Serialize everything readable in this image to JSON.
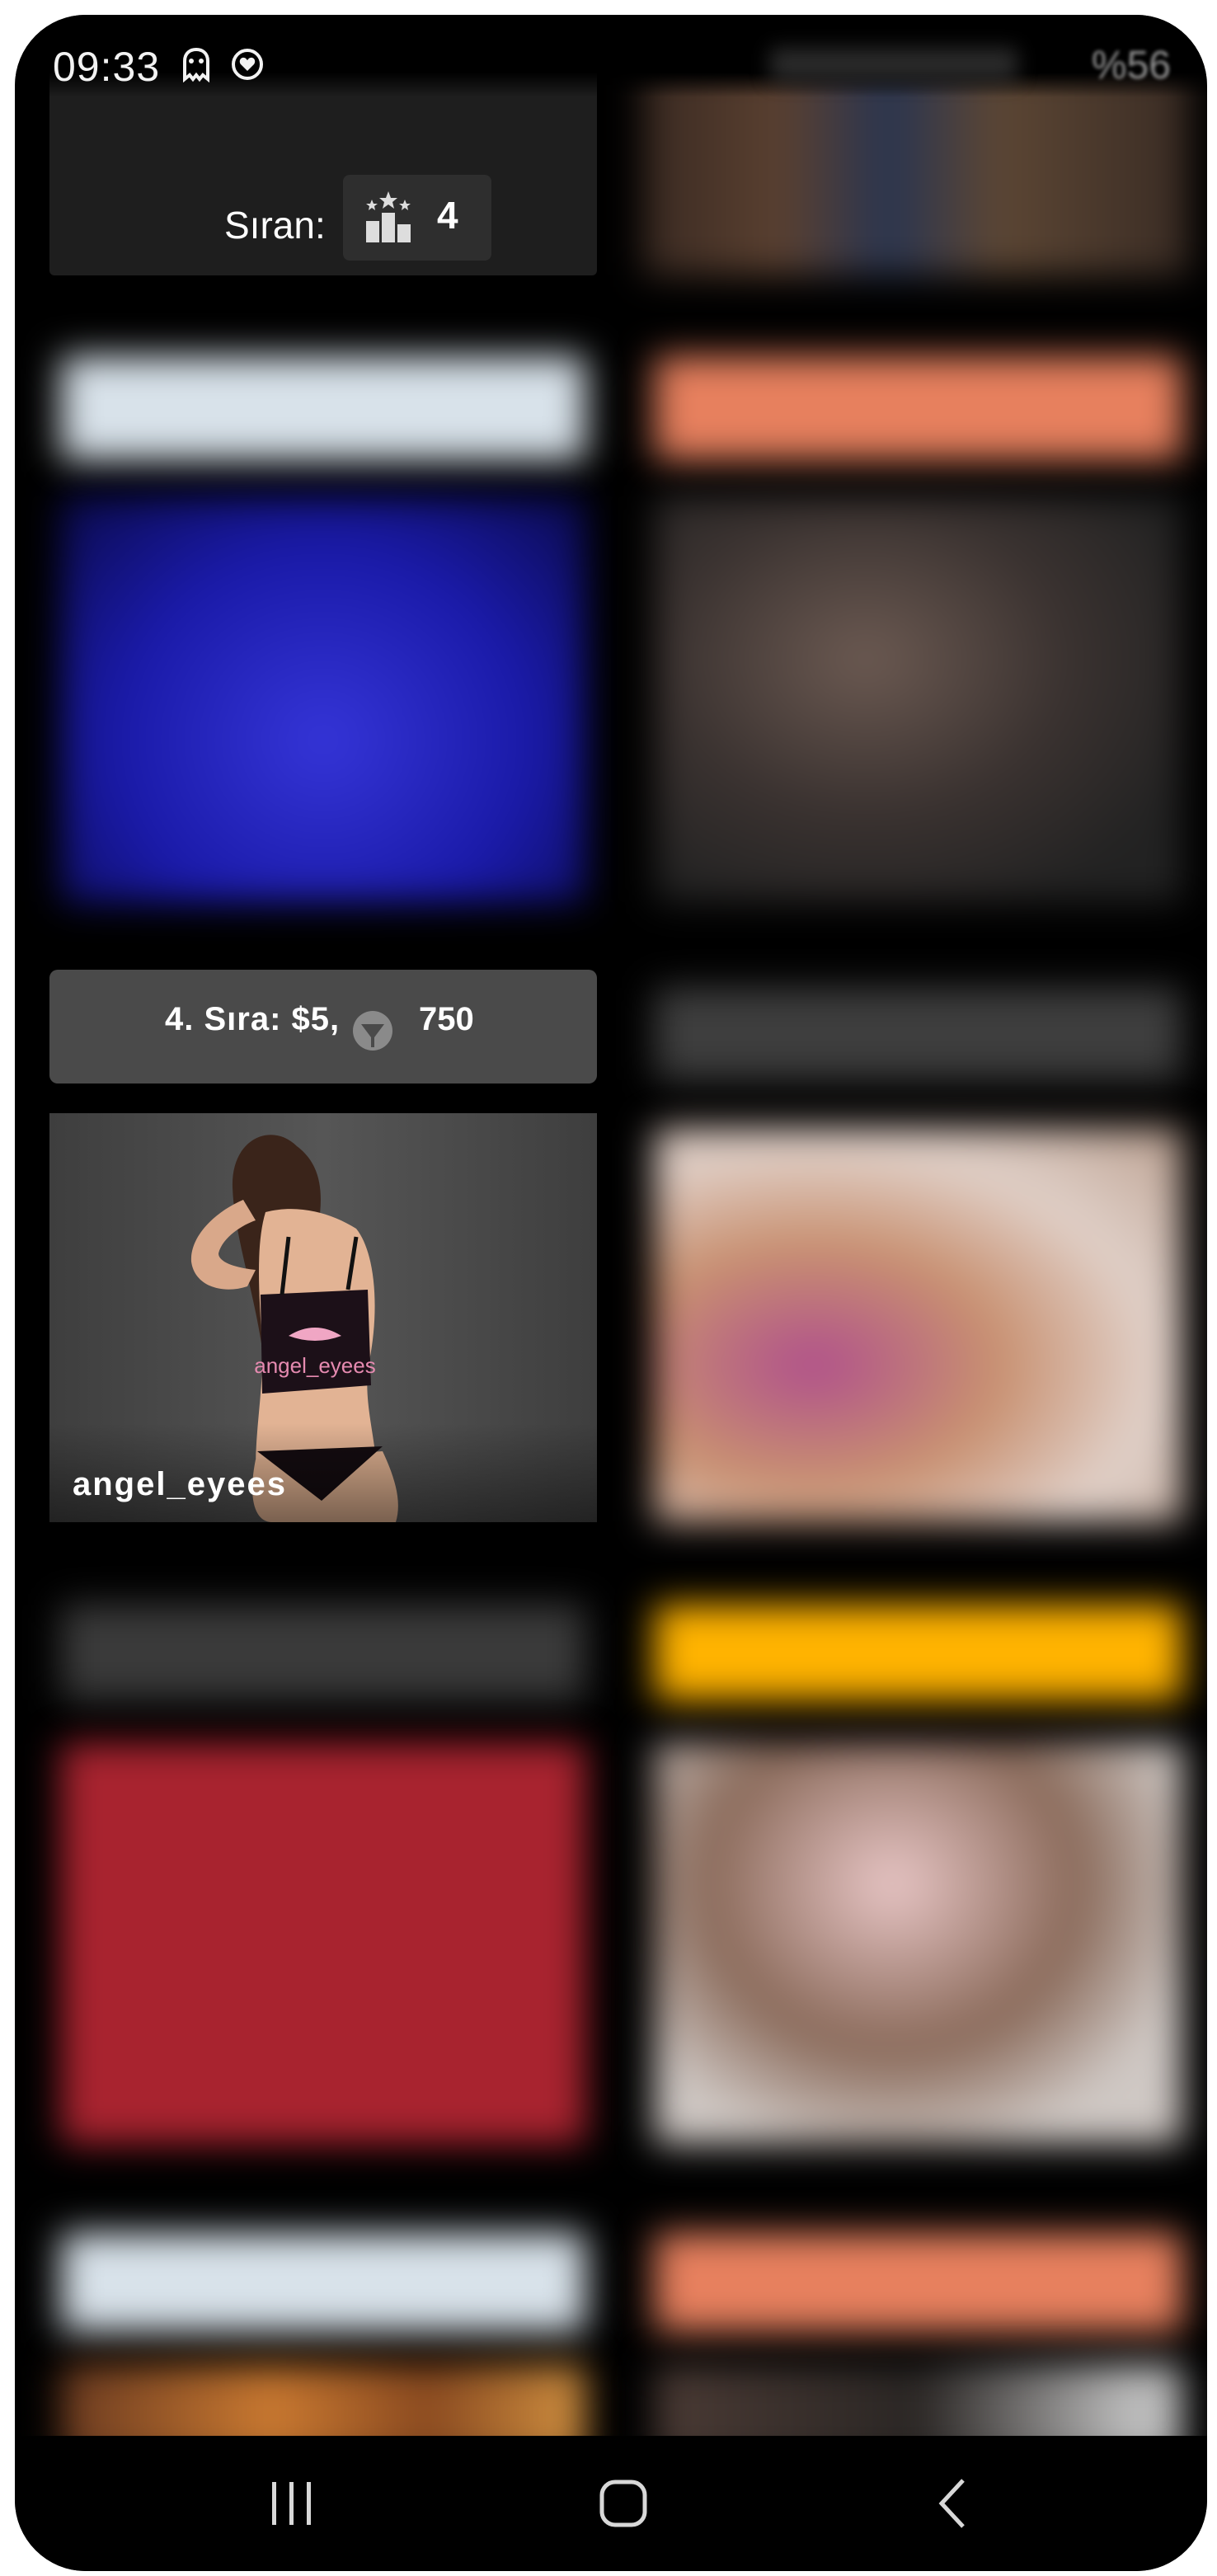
{
  "status_bar": {
    "time": "09:33",
    "battery": "%56"
  },
  "rank": {
    "label": "Sıran:",
    "value": "4",
    "icon": "leaderboard-podium-icon"
  },
  "queue": {
    "text": "4. Sıra: $5,",
    "tokens_icon": "tokens-chat-icon",
    "tokens": "750"
  },
  "featured_model": {
    "username": "angel_eyees",
    "tank_print": "angel_eyees"
  },
  "nav": {
    "recents": "recent-apps-icon",
    "home": "home-icon",
    "back": "back-icon"
  },
  "colors": {
    "orange_banner": "#e7805e",
    "yellow_banner": "#ffb300",
    "red_tile": "#a8232f",
    "light_banner": "#d8e2ea"
  }
}
